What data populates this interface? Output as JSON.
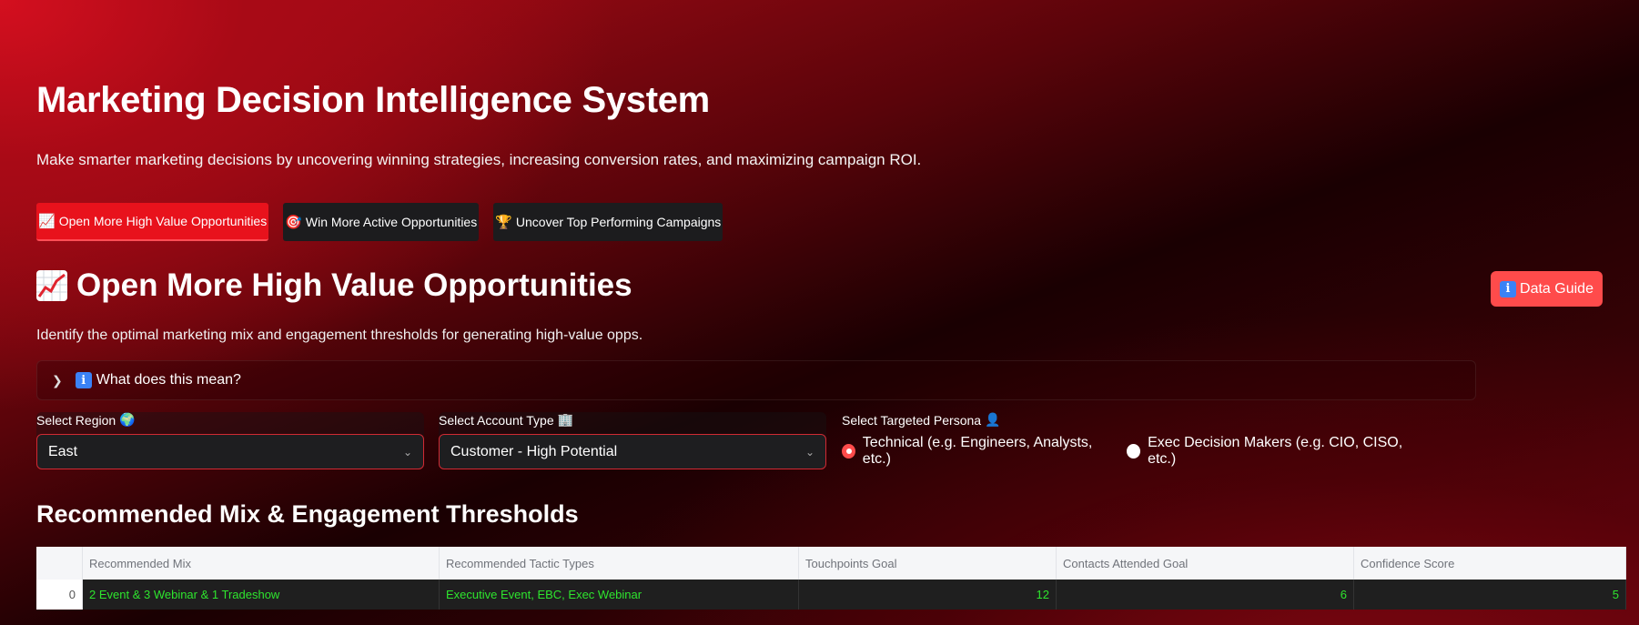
{
  "page": {
    "title": "Marketing Decision Intelligence System",
    "subtitle": "Make smarter marketing decisions by uncovering winning strategies, increasing conversion rates, and maximizing campaign ROI."
  },
  "tabs": [
    {
      "icon": "📈",
      "label": "Open More High Value Opportunities",
      "active": true
    },
    {
      "icon": "🎯",
      "label": "Win More Active Opportunities",
      "active": false
    },
    {
      "icon": "🏆",
      "label": "Uncover Top Performing Campaigns",
      "active": false
    }
  ],
  "section": {
    "title": "Open More High Value Opportunities",
    "description": "Identify the optimal marketing mix and engagement thresholds for generating high-value opps.",
    "data_guide_label": "Data Guide",
    "expander_label": "What does this mean?"
  },
  "filters": {
    "region": {
      "label": "Select Region",
      "icon": "🌍",
      "value": "East"
    },
    "account_type": {
      "label": "Select Account Type",
      "icon": "🏢",
      "value": "Customer - High Potential"
    },
    "persona": {
      "label": "Select Targeted Persona",
      "icon": "👤",
      "options": [
        {
          "label": "Technical (e.g. Engineers, Analysts, etc.)",
          "selected": true
        },
        {
          "label": "Exec Decision Makers (e.g. CIO, CISO, etc.)",
          "selected": false
        }
      ]
    }
  },
  "table": {
    "title": "Recommended Mix & Engagement Thresholds",
    "columns": [
      "Recommended Mix",
      "Recommended Tactic Types",
      "Touchpoints Goal",
      "Contacts Attended Goal",
      "Confidence Score"
    ],
    "rows": [
      {
        "index": "0",
        "mix": "2 Event & 3 Webinar & 1 Tradeshow",
        "tactics": "Executive Event, EBC, Exec Webinar",
        "touchpoints": "12",
        "contacts": "6",
        "confidence": "5"
      }
    ]
  },
  "colors": {
    "accent": "#ff4b4b",
    "table_text": "#2ee52e",
    "tab_active": "#e8121c"
  }
}
